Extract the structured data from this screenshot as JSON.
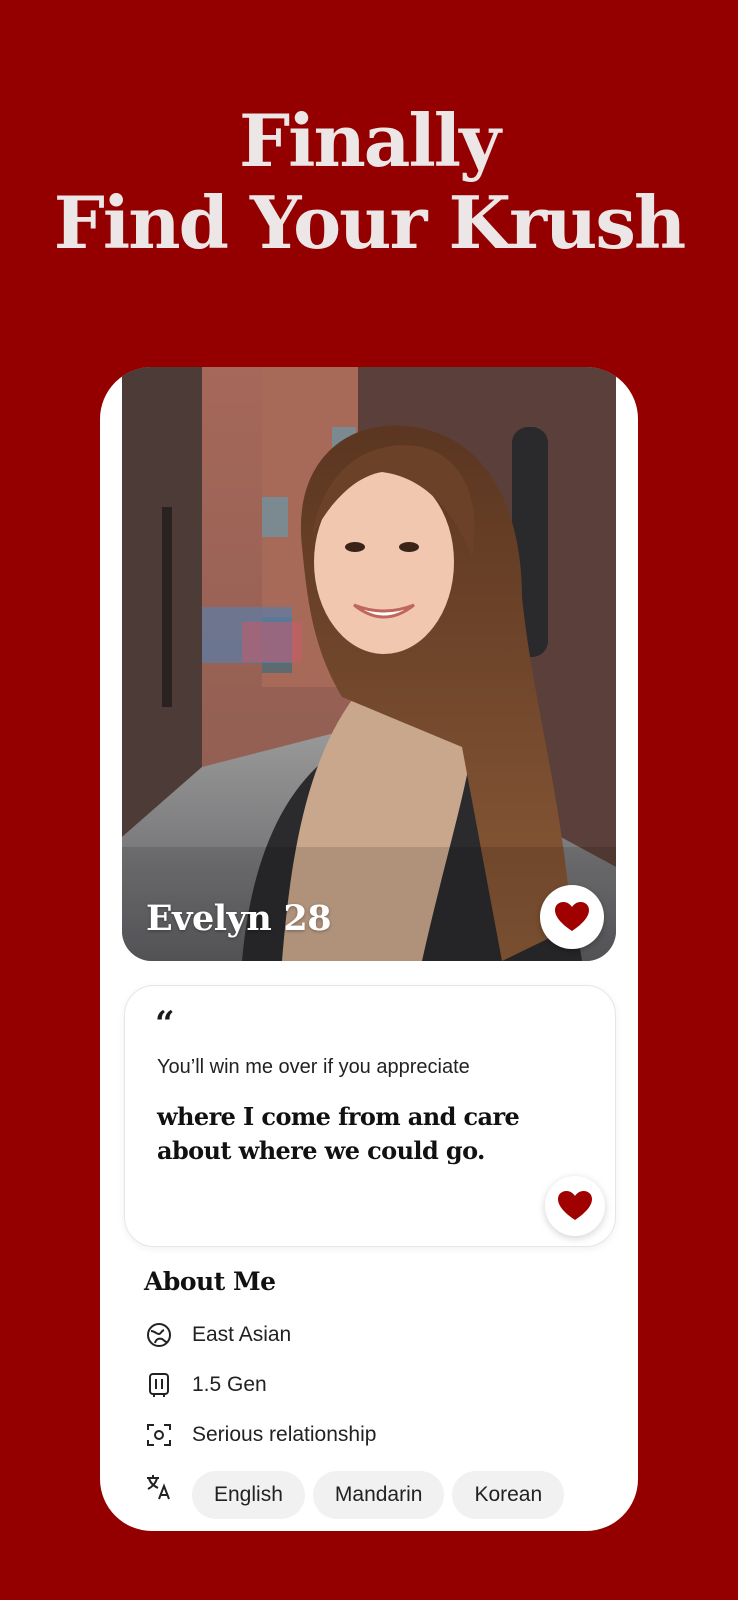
{
  "headline": {
    "line1": "Finally",
    "line2": "Find Your Krush"
  },
  "profile": {
    "name": "Evelyn",
    "age": "28"
  },
  "prompt": {
    "quote_mark": "“",
    "question": "You’ll win me over if you appreciate",
    "answer": "where I come from and care about where we could go."
  },
  "about": {
    "title": "About Me",
    "items": [
      {
        "icon": "ethnicity-icon",
        "label": "East Asian"
      },
      {
        "icon": "generation-icon",
        "label": "1.5 Gen"
      },
      {
        "icon": "relationship-goal-icon",
        "label": "Serious relationship"
      }
    ],
    "languages_icon": "translate-icon",
    "languages": [
      "English",
      "Mandarin",
      "Korean"
    ]
  },
  "colors": {
    "brand": "#940000",
    "heart": "#a00000",
    "headline": "#ece6e6"
  }
}
